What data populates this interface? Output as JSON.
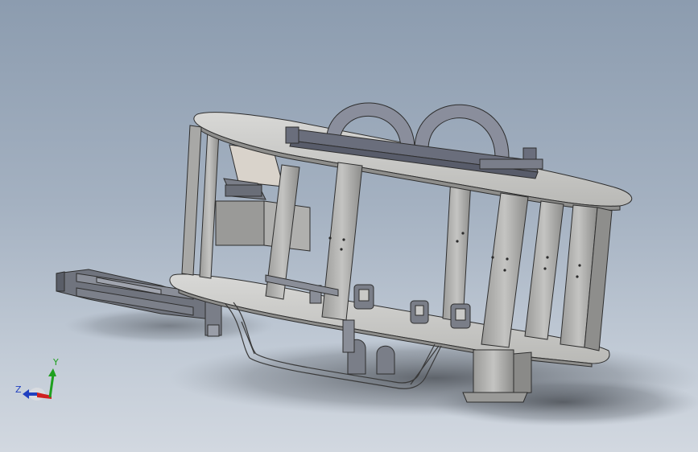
{
  "viewport": {
    "background_top": "#8c9caf",
    "background_bottom": "#d2d8e0",
    "part_color": "#c8c8c8",
    "edge_color": "#3a3a3a",
    "bracket_color": "#6e7280"
  },
  "triad": {
    "x_label": "",
    "y_label": "Y",
    "z_label": "Z",
    "x_color": "#d02020",
    "y_color": "#1fa01f",
    "z_color": "#2040c0"
  }
}
